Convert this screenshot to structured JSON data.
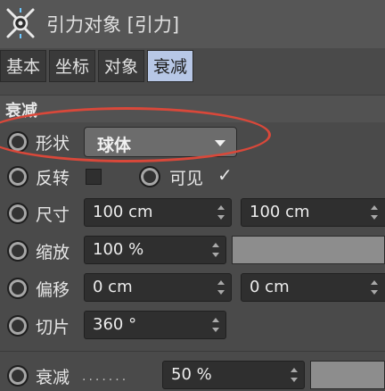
{
  "header": {
    "title": "引力对象 [引力]",
    "icon": "gravity-object-icon"
  },
  "tabs": [
    {
      "label": "基本",
      "active": false
    },
    {
      "label": "坐标",
      "active": false
    },
    {
      "label": "对象",
      "active": false
    },
    {
      "label": "衰减",
      "active": true
    }
  ],
  "section": {
    "title": "衰减"
  },
  "rows": {
    "shape": {
      "label": "形状",
      "value": "球体"
    },
    "invert": {
      "label": "反转",
      "checked": false
    },
    "visible": {
      "label": "可见",
      "check_glyph": "✓",
      "checked": true
    },
    "size": {
      "label": "尺寸",
      "value1": "100 cm",
      "value2": "100 cm"
    },
    "scale": {
      "label": "缩放",
      "value": "100 %"
    },
    "offset": {
      "label": "偏移",
      "value1": "0 cm",
      "value2": "0 cm"
    },
    "slice": {
      "label": "切片",
      "value": "360 °"
    },
    "falloff": {
      "label": "衰减",
      "dots": ".......",
      "value": "50 %"
    }
  },
  "colors": {
    "active_tab": "#b7c7e6",
    "highlight": "#d9483a",
    "panel": "#4a4a4a"
  }
}
